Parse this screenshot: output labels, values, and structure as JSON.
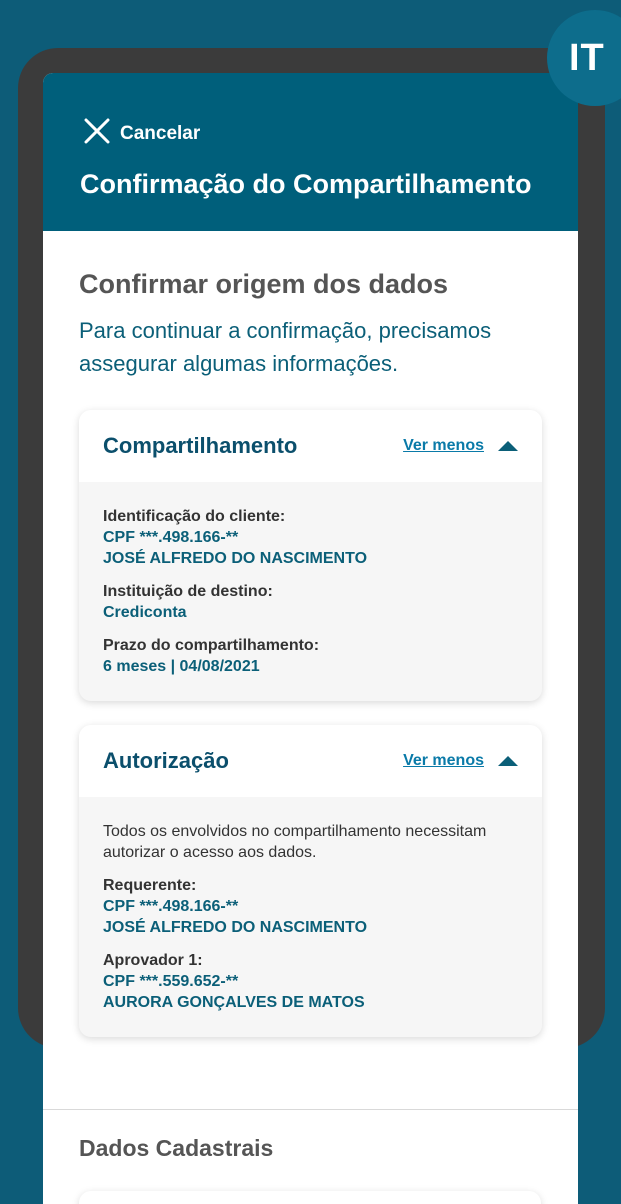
{
  "badge": "IT",
  "header": {
    "cancel_label": "Cancelar",
    "title": "Confirmação do Compartilhamento"
  },
  "section": {
    "title": "Confirmar origem dos dados",
    "description": "Para continuar a confirmação, precisamos assegurar algumas informações."
  },
  "cards": {
    "sharing": {
      "title": "Compartilhamento",
      "toggle": "Ver menos",
      "fields": [
        {
          "label": "Identificação do cliente:",
          "line1": "CPF ***.498.166-**",
          "line2": "JOSÉ ALFREDO DO NASCIMENTO"
        },
        {
          "label": "Instituição de destino:",
          "line1": "Crediconta"
        },
        {
          "label": "Prazo do compartilhamento:",
          "line1": "6 meses | 04/08/2021"
        }
      ]
    },
    "authorization": {
      "title": "Autorização",
      "toggle": "Ver menos",
      "note": "Todos os envolvidos no compartilhamento necessitam autorizar o acesso aos dados.",
      "fields": [
        {
          "label": "Requerente:",
          "line1": "CPF ***.498.166-**",
          "line2": "JOSÉ ALFREDO DO NASCIMENTO"
        },
        {
          "label": "Aprovador 1:",
          "line1": "CPF ***.559.652-**",
          "line2": "AURORA GONÇALVES DE MATOS"
        }
      ]
    }
  },
  "section2": {
    "title": "Dados Cadastrais"
  },
  "colors": {
    "background": "#0d5c78",
    "header": "#005f7b",
    "accent_text": "#0b5f78",
    "link": "#0a7aa8",
    "device_frame": "#3b3b3b"
  }
}
